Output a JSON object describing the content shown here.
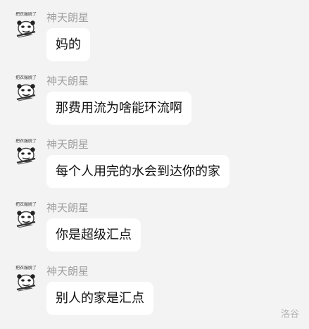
{
  "chat": {
    "messages": [
      {
        "sender": "神天朗星",
        "avatar_caption": "把衣服脱了",
        "text": "妈的"
      },
      {
        "sender": "神天朗星",
        "avatar_caption": "把衣服脱了",
        "text": "那费用流为啥能环流啊"
      },
      {
        "sender": "神天朗星",
        "avatar_caption": "把衣服脱了",
        "text": "每个人用完的水会到达你的家"
      },
      {
        "sender": "神天朗星",
        "avatar_caption": "把衣服脱了",
        "text": "你是超级汇点"
      },
      {
        "sender": "神天朗星",
        "avatar_caption": "把衣服脱了",
        "text": "别人的家是汇点"
      }
    ]
  },
  "watermark": "洛谷",
  "icons": {
    "avatar": "panda-meme-face-icon"
  }
}
